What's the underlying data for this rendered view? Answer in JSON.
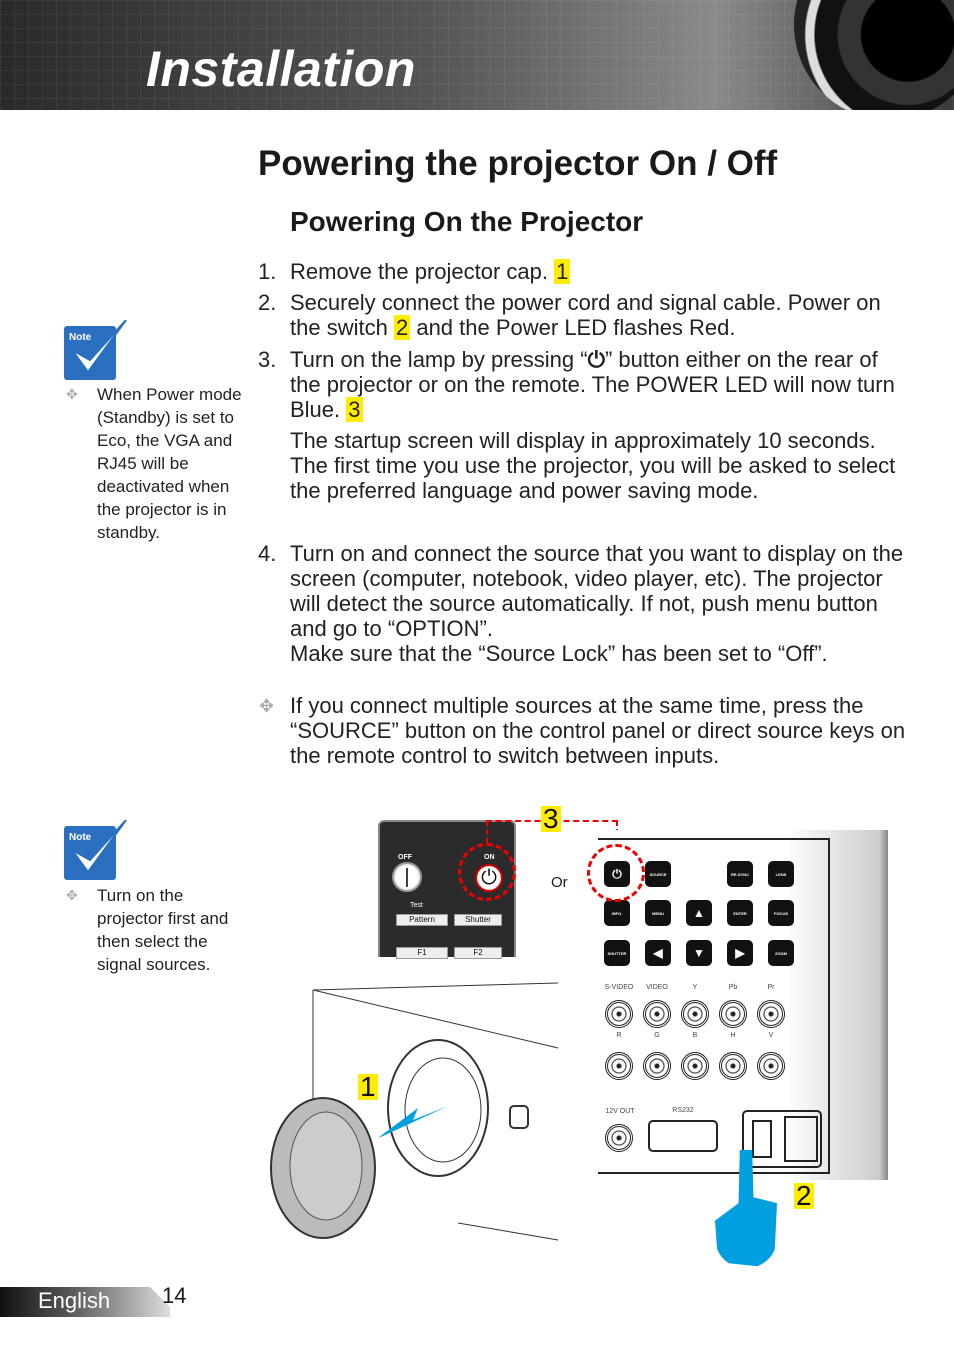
{
  "header": {
    "section_title": "Installation"
  },
  "page_title": "Powering the projector On / Off",
  "subtitle": "Powering On the Projector",
  "steps": [
    {
      "num": "1.",
      "text": "Remove the projector cap.",
      "callout": "1"
    },
    {
      "num": "2.",
      "text_a": "Securely connect the power cord and signal cable. Power on the switch",
      "callout": "2",
      "text_b": "and the Power LED flashes Red."
    },
    {
      "num": "3.",
      "text_a": "Turn on the lamp by pressing “",
      "icon": "⏻",
      "text_b": "” button either on the rear of the projector or on the remote. The POWER LED will now turn Blue.",
      "callout": "3",
      "extra": "The startup screen will display in approximately 10 seconds. The first time you use the projector, you will be asked to select the preferred language and power saving mode."
    },
    {
      "num": "4.",
      "text": "Turn on and connect the source that you want to display on the screen (computer, notebook, video player, etc). The projector will detect the source automatically. If not, push menu button and go to “OPTION”.",
      "extra": "Make sure that the “Source Lock” has been set to “Off”."
    }
  ],
  "tip": "If you connect multiple sources at the same time, press the “SOURCE” button on the control panel or direct source keys on the remote control to switch between inputs.",
  "notes": [
    {
      "label": "Note",
      "text": "When Power mode (Standby) is set to Eco, the VGA and RJ45 will be deactivated when the projector is in standby."
    },
    {
      "label": "Note",
      "text": "Turn on the projector first and then select the signal sources."
    }
  ],
  "diagram": {
    "remote": {
      "off": "OFF",
      "on": "ON",
      "test": "Test",
      "pattern": "Pattern",
      "shutter": "Shutter",
      "f1": "F1",
      "f2": "F2"
    },
    "or": "Or",
    "callouts": [
      "1",
      "2",
      "3"
    ],
    "panel_buttons": [
      "⏻",
      "SOURCE",
      "RE-SYNC",
      "LENS",
      "INFO.",
      "MENU",
      "▲",
      "ENTER",
      "FOCUS",
      "SHUTTER",
      "◀",
      "▼",
      "▶",
      "ZOOM"
    ],
    "ports_top": [
      "S-VIDEO",
      "VIDEO",
      "Y",
      "Pb",
      "Pr"
    ],
    "ports_bnc": [
      "R",
      "G",
      "B",
      "H",
      "V"
    ],
    "out_label": "12V OUT",
    "rs232": "RS232",
    "accent": "#00a0e0",
    "dash_color": "#e00000"
  },
  "footer": {
    "language": "English",
    "page": "14"
  }
}
